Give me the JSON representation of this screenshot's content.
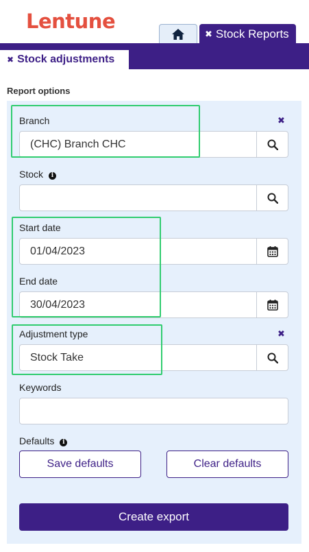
{
  "header": {
    "logo_text": "Lentune",
    "home_tab_icon": "home-icon",
    "active_tab_label": "Stock Reports",
    "close_glyph": "✖"
  },
  "sub_tab": {
    "label": "Stock adjustments",
    "close_glyph": "✖"
  },
  "report_options": {
    "title": "Report options",
    "branch": {
      "label": "Branch",
      "value": "(CHC) Branch CHC",
      "clear_glyph": "✖"
    },
    "stock": {
      "label": "Stock",
      "value": ""
    },
    "start_date": {
      "label": "Start date",
      "value": "01/04/2023"
    },
    "end_date": {
      "label": "End date",
      "value": "30/04/2023"
    },
    "adjustment_type": {
      "label": "Adjustment type",
      "value": "Stock Take",
      "clear_glyph": "✖"
    },
    "keywords": {
      "label": "Keywords",
      "value": ""
    },
    "defaults": {
      "label": "Defaults",
      "save_label": "Save defaults",
      "clear_label": "Clear defaults"
    },
    "create_export_label": "Create export"
  },
  "colors": {
    "brand_red": "#e4503f",
    "primary_purple": "#3d1f86",
    "panel_bg": "#e6f0fc",
    "highlight_green": "#2fcc6e"
  }
}
